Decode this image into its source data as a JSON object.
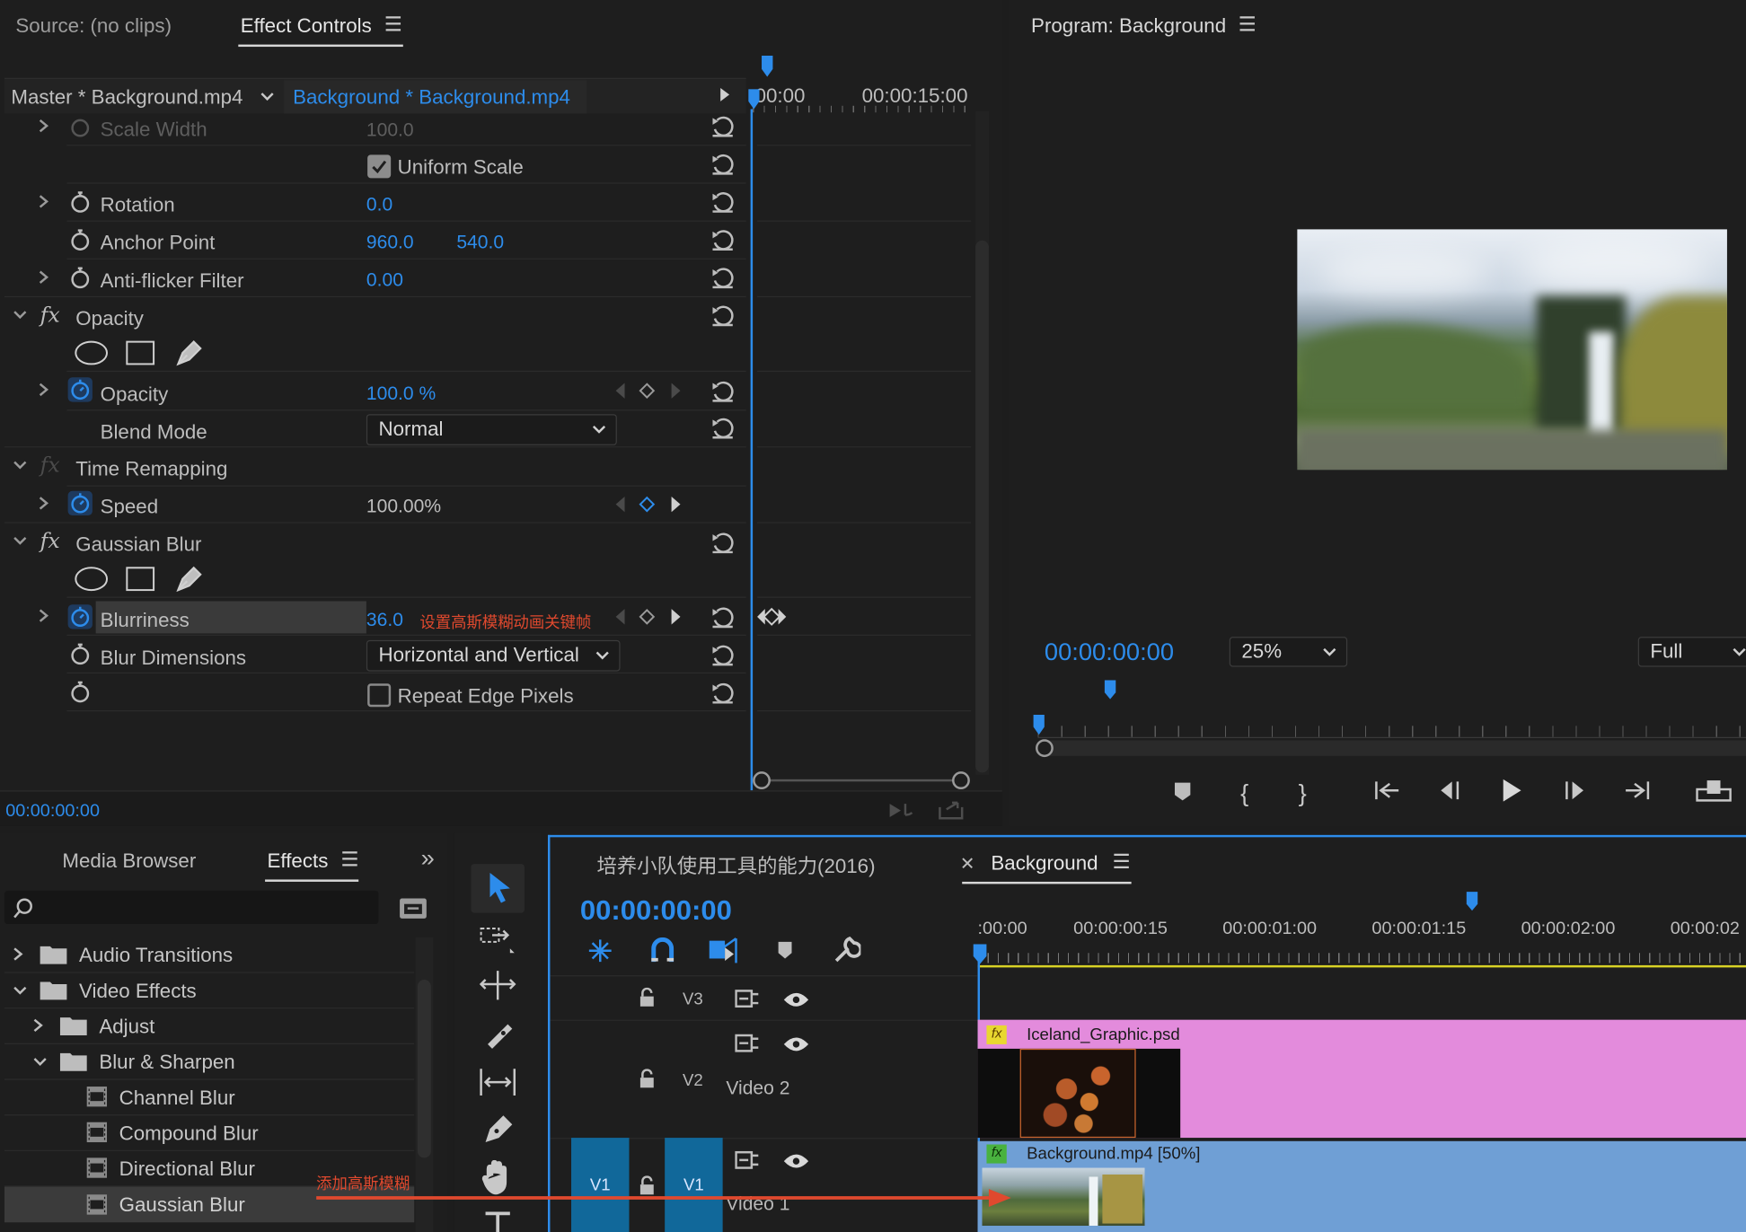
{
  "source_panel": {
    "tab_source": "Source: (no clips)",
    "tab_effect_controls": "Effect Controls"
  },
  "effect_controls": {
    "master_label": "Master * Background.mp4",
    "clip_label": "Background * Background.mp4",
    "ruler_start": "00:00",
    "ruler_mid": "00:00:15:00",
    "rows": {
      "scale_width": {
        "label": "Scale Width",
        "value": "100.0"
      },
      "uniform_scale": {
        "label": "Uniform Scale"
      },
      "rotation": {
        "label": "Rotation",
        "value": "0.0"
      },
      "anchor_point": {
        "label": "Anchor Point",
        "x": "960.0",
        "y": "540.0"
      },
      "anti_flicker": {
        "label": "Anti-flicker Filter",
        "value": "0.00"
      },
      "opacity_group": {
        "label": "Opacity"
      },
      "opacity": {
        "label": "Opacity",
        "value": "100.0 %"
      },
      "blend_mode": {
        "label": "Blend Mode",
        "value": "Normal"
      },
      "time_remap": {
        "label": "Time Remapping"
      },
      "speed": {
        "label": "Speed",
        "value": "100.00%"
      },
      "gaussian_blur": {
        "label": "Gaussian Blur"
      },
      "blurriness": {
        "label": "Blurriness",
        "value": "36.0",
        "note": "设置高斯模糊动画关键帧"
      },
      "blur_dimensions": {
        "label": "Blur Dimensions",
        "value": "Horizontal and Vertical"
      },
      "repeat_edge": {
        "label": "Repeat Edge Pixels"
      }
    },
    "timecode": "00:00:00:00"
  },
  "program": {
    "title": "Program: Background",
    "timecode": "00:00:00:00",
    "zoom": "25%",
    "quality": "Full"
  },
  "effects_panel": {
    "tab_media_browser": "Media Browser",
    "tab_effects": "Effects",
    "tree": {
      "audio_transitions": "Audio Transitions",
      "video_effects": "Video Effects",
      "adjust": "Adjust",
      "blur_sharpen": "Blur & Sharpen",
      "channel_blur": "Channel Blur",
      "compound_blur": "Compound Blur",
      "directional_blur": "Directional Blur",
      "gaussian_blur": "Gaussian Blur"
    },
    "note": "添加高斯模糊"
  },
  "timeline": {
    "tab_project": "培养小队使用工具的能力(2016)",
    "tab_sequence": "Background",
    "timecode": "00:00:00:00",
    "ruler": [
      ":00:00",
      "00:00:00:15",
      "00:00:01:00",
      "00:00:01:15",
      "00:00:02:00",
      "00:00:02"
    ],
    "tracks": {
      "v3": "V3",
      "v2": "V2",
      "v2_name": "Video 2",
      "v1_src": "V1",
      "v1": "V1",
      "v1_name": "Video 1"
    },
    "clips": {
      "graphic": "Iceland_Graphic.psd",
      "background": "Background.mp4 [50%]",
      "fx": "fx"
    },
    "colors": {
      "graphic_clip": "#e38bdc",
      "background_clip": "#6f9fd5",
      "accent": "#2d8ceb",
      "annotation": "#e0492e"
    }
  }
}
